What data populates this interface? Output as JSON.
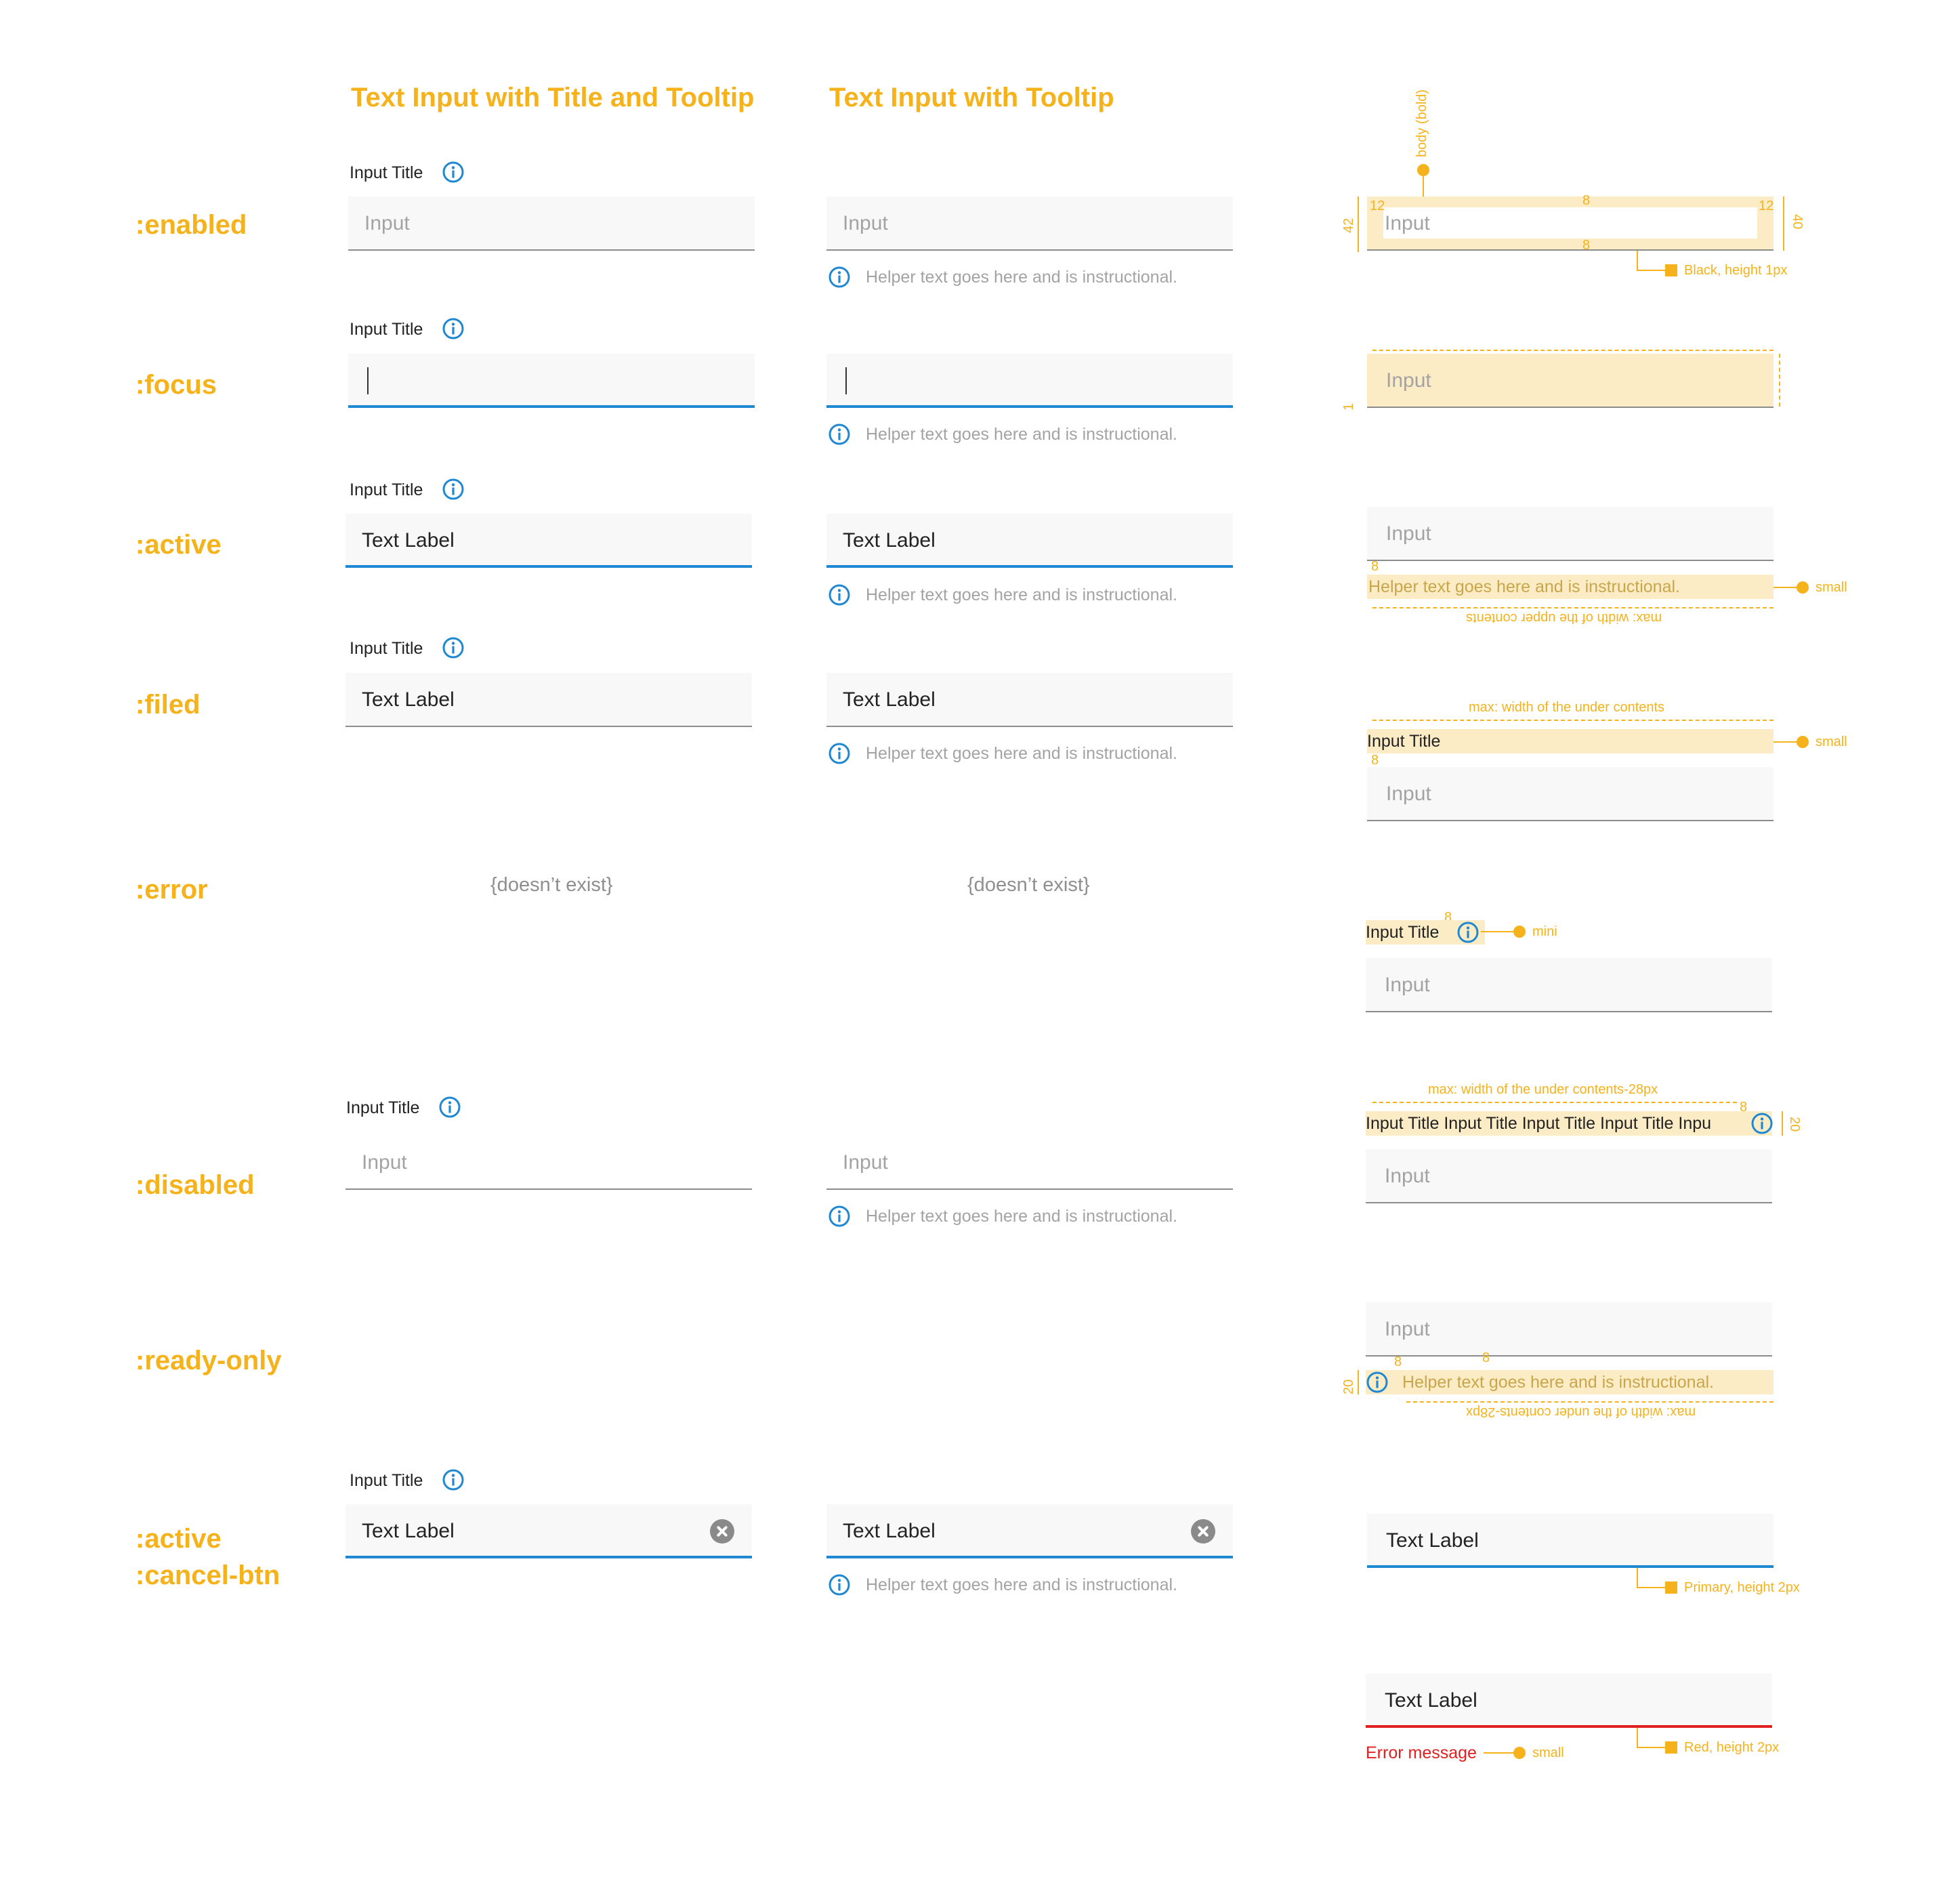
{
  "colors": {
    "accent": "#f5b21b",
    "primary": "#1e88d2",
    "error": "#e02020",
    "placeholder": "#a3a3a3",
    "text": "#222222",
    "field_bg": "#f8f8f8",
    "highlight": "#fcecc6"
  },
  "columns": {
    "col1_title": "Text Input with Title and Tooltip",
    "col2_title": "Text Input with Tooltip"
  },
  "states": {
    "enabled": ":enabled",
    "focus": ":focus",
    "active": ":active",
    "filed": ":filed",
    "error": ":error",
    "disabled": ":disabled",
    "ready_only": ":ready-only",
    "active_cancel_line1": ":active",
    "active_cancel_line2": ":cancel-btn"
  },
  "common": {
    "input_title": "Input Title",
    "placeholder": "Input",
    "text_label": "Text Label",
    "helper": "Helper text goes here and is instructional.",
    "doesnt_exist": "{doesn’t exist}",
    "info_icon": "info-icon",
    "clear_icon": "clear-icon"
  },
  "spec": {
    "body_bold": "body (bold)",
    "n12": "12",
    "n8": "8",
    "n42": "42",
    "n40": "40",
    "n1": "1",
    "n20": "20",
    "black_height": "Black, height 1px",
    "small": "small",
    "mini": "mini",
    "max_upper": "max: width of the upper contents",
    "max_under": "max: width of the under contents",
    "max_under_28": "max: width of the under contents-28px",
    "long_title": "Input Title Input Title Input Title Input Title Inpu",
    "primary_height": "Primary, height 2px",
    "red_height": "Red, height 2px",
    "error_message": "Error message"
  }
}
